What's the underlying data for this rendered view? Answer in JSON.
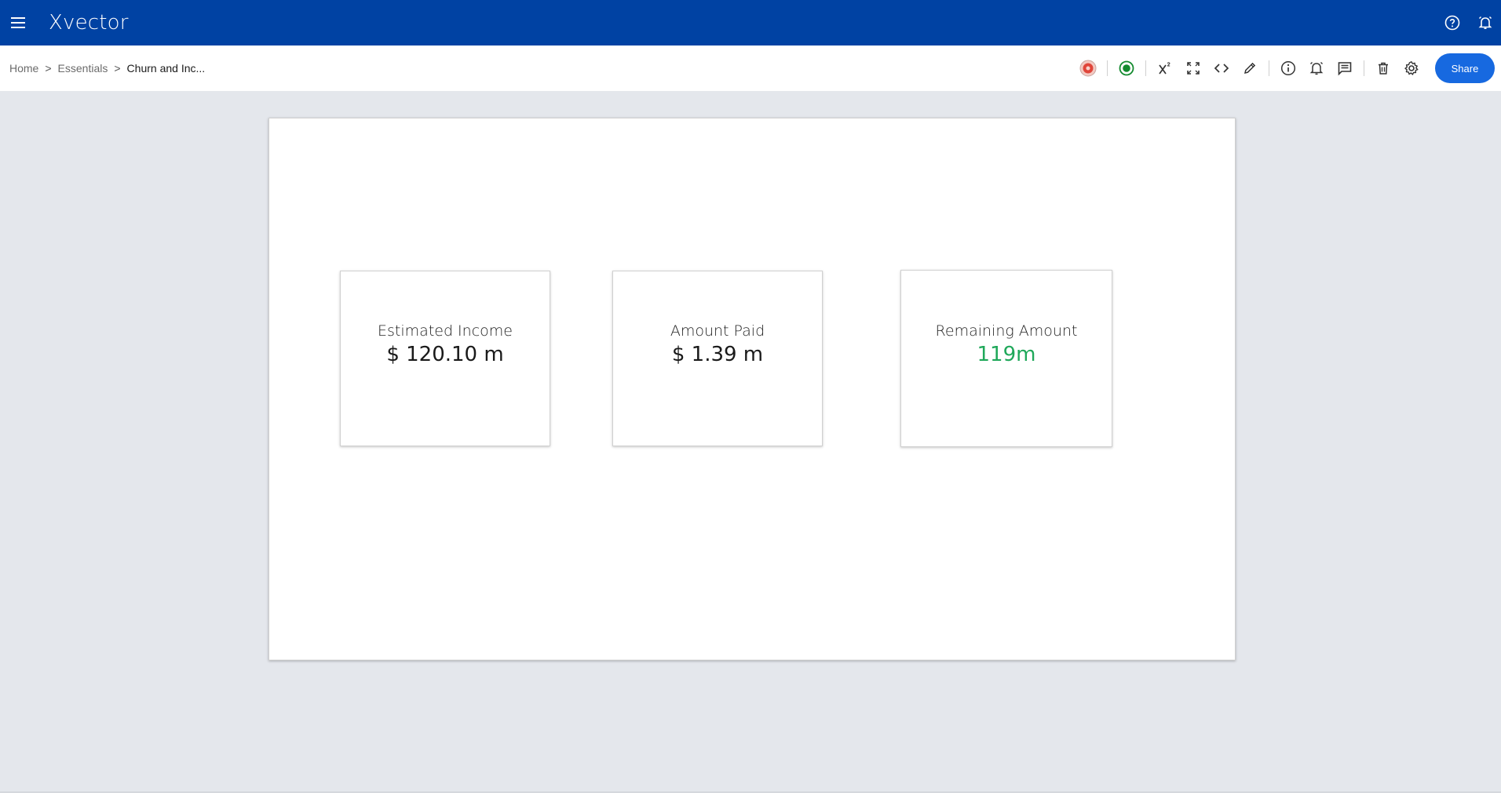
{
  "app": {
    "name": "Xvector"
  },
  "breadcrumb": {
    "items": [
      "Home",
      "Essentials",
      "Churn and Inc..."
    ],
    "separator": ">"
  },
  "toolbar": {
    "share_label": "Share",
    "icons": [
      "status-badge-icon",
      "live-indicator-icon",
      "formula-icon",
      "fullscreen-icon",
      "code-icon",
      "edit-icon",
      "info-icon",
      "alert-bell-icon",
      "comment-icon",
      "delete-icon",
      "settings-icon"
    ]
  },
  "cards": [
    {
      "label": "Estimated Income",
      "value": "$ 120.10 m"
    },
    {
      "label": "Amount Paid",
      "value": "$ 1.39 m"
    },
    {
      "label": "Remaining Amount",
      "value": "119m"
    }
  ],
  "colors": {
    "header": "#0042a3",
    "accent": "#1769e0",
    "positive": "#1fa85a"
  }
}
